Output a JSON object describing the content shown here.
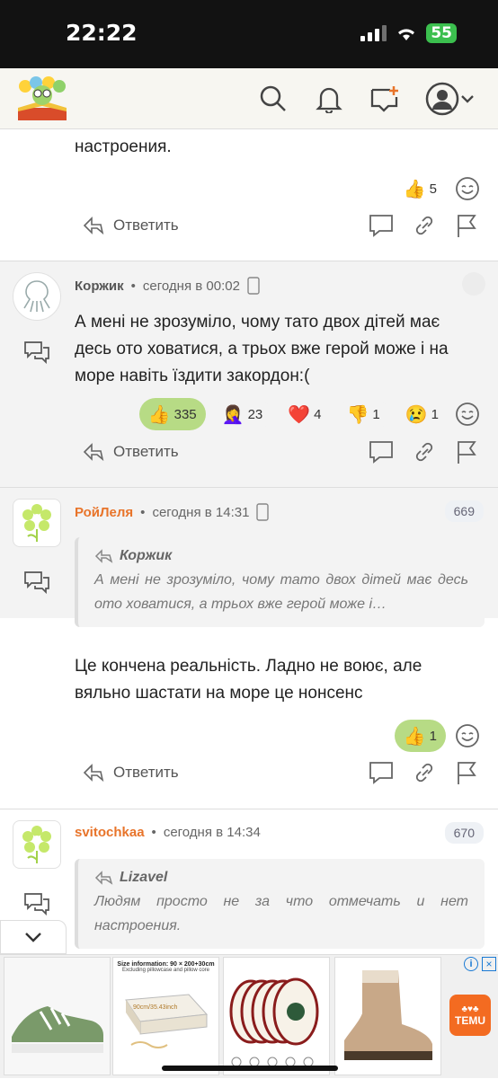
{
  "status": {
    "time": "22:22",
    "battery": "55"
  },
  "comments": {
    "prev": {
      "text": "настроения.",
      "reactions": [
        {
          "emoji": "👍",
          "count": "5"
        }
      ],
      "reply": "Ответить"
    },
    "c1": {
      "nick": "Коржик",
      "sep": "•",
      "time": "сегодня в 00:02",
      "text": "А мені не зрозуміло, чому тато двох дітей має десь ото ховатися, а трьох вже герой може і на море навіть їздити закордон:(",
      "reactions": [
        {
          "emoji": "👍",
          "count": "335"
        },
        {
          "emoji": "🤦‍♀️",
          "count": "23"
        },
        {
          "emoji": "❤️",
          "count": "4"
        },
        {
          "emoji": "👎",
          "count": "1"
        },
        {
          "emoji": "😢",
          "count": "1"
        }
      ],
      "reply": "Ответить"
    },
    "c2": {
      "nick": "РойЛеля",
      "sep": "•",
      "time": "сегодня в 14:31",
      "number": "669",
      "quote_nick": "Коржик",
      "quote_text": "А мені не зрозуміло, чому тато двох дітей має десь ото ховатися, а трьох вже герой може і…",
      "text": "Це кончена реальність. Ладно не воює, але вяльно шастати на море це нонсенс",
      "reactions": [
        {
          "emoji": "👍",
          "count": "1"
        }
      ],
      "reply": "Ответить"
    },
    "c3": {
      "nick": "svitochkaa",
      "sep": "•",
      "time": "сегодня в 14:34",
      "number": "670",
      "quote_nick": "Lizavel",
      "quote_text": "Людям просто не за что отмечать и нет настроения."
    }
  },
  "ad": {
    "mattress_title": "Size information: 90 × 200+30cm",
    "mattress_sub": "Excluding pillowcase and pillow core",
    "mattress_w": "90cm/35.43inch",
    "temu_label": "TEMU"
  },
  "colors": {
    "accent": "#e8742a",
    "like_active": "#b7db85"
  }
}
